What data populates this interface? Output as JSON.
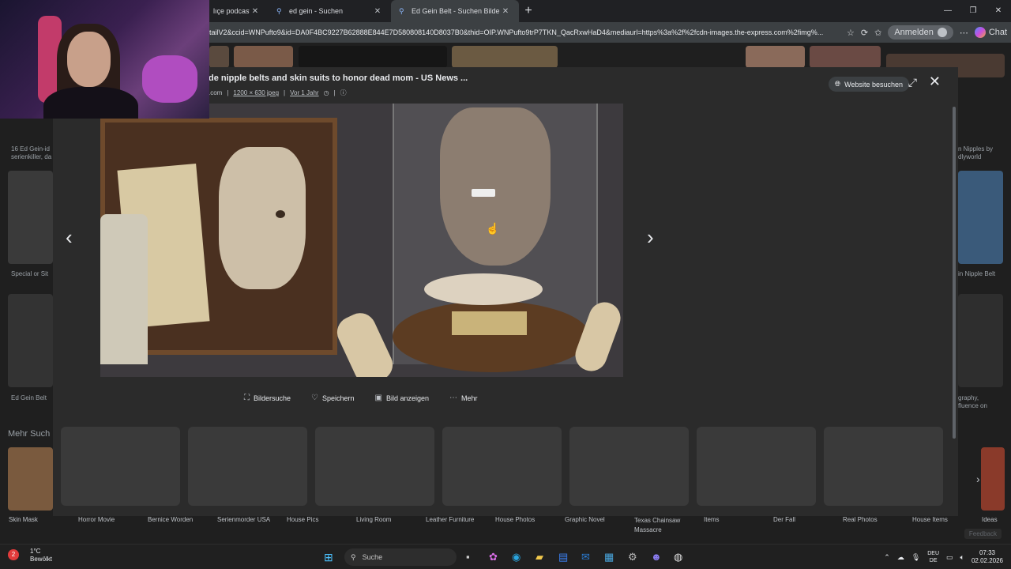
{
  "tabs": [
    {
      "label": "lıçe podcast pang",
      "close": "✕"
    },
    {
      "label": "ed gein - Suchen",
      "close": "✕"
    },
    {
      "label": "Ed Gein Belt - Suchen Bilder",
      "close": "✕",
      "active": true
    }
  ],
  "new_tab": "+",
  "window_controls": {
    "min": "—",
    "max": "❐",
    "close": "✕"
  },
  "address": {
    "url": "tailV2&ccid=WNPufto9&id=DA0F4BC9227B62888E844E7D580808140D8037B0&thid=OIP.WNPufto9trP7TKN_QacRxwHaD4&mediaurl=https%3a%2f%2fcdn-images.the-express.com%2fimg%...",
    "signin_label": "Anmelden",
    "chat_label": "Chat"
  },
  "viewer": {
    "title": "de nipple belts and skin suits to honor dead mom - US News ...",
    "meta_domain": ".com",
    "meta_size": "1200 × 630 jpeg",
    "meta_age": "Vor 1 Jahr",
    "visit_label": "Website besuchen",
    "actions": [
      {
        "label": "Bildersuche",
        "icon": "visual-search-icon"
      },
      {
        "label": "Speichern",
        "icon": "save-icon"
      },
      {
        "label": "Bild anzeigen",
        "icon": "view-image-icon"
      },
      {
        "label": "Mehr",
        "icon": "more-icon"
      }
    ]
  },
  "background_labels": {
    "left_top": "16 Ed Gein-id serienkiller, da",
    "left_mid": "Special or Sit",
    "left_bottom": "Ed Gein Belt",
    "more_heading": "Mehr Such",
    "right_top": "n Nipples by dlyworld",
    "right_mid": "in Nipple Belt",
    "right_bottom": "graphy, fluence on"
  },
  "related_chips": [
    "Skin Mask",
    "Horror Movie",
    "Bernice Worden",
    "Serienmorder USA",
    "House Pics",
    "Living Room",
    "Leather Furniture",
    "House Photos",
    "Graphic Novel",
    "Texas Chainsaw Massacre",
    "Items",
    "Der Fall",
    "Real Photos",
    "House Items",
    "Ideas"
  ],
  "feedback_label": "Feedback",
  "taskbar": {
    "weather_temp": "1°C",
    "weather_desc": "Bewölkt",
    "weather_badge": "2",
    "search_placeholder": "Suche",
    "lang_top": "DEU",
    "lang_bottom": "DE",
    "time": "07:33",
    "date": "02.02.2026"
  }
}
